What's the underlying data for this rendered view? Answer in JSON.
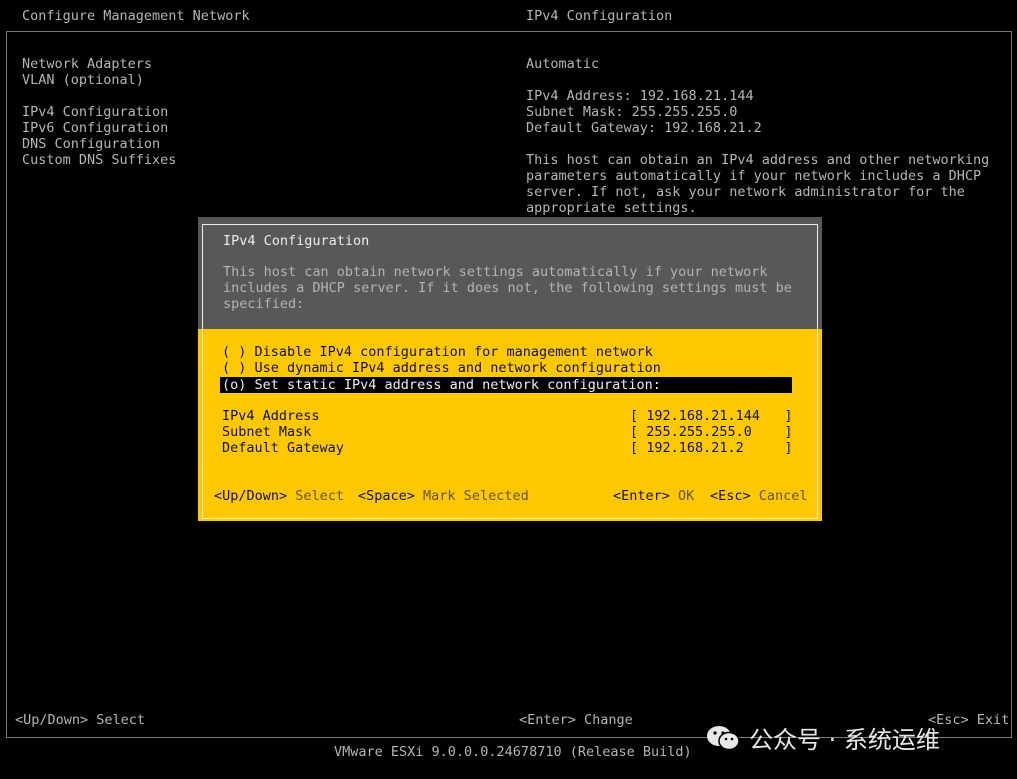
{
  "left_pane": {
    "title": "Configure Management Network",
    "items": [
      "Network Adapters",
      "VLAN (optional)",
      "IPv4 Configuration",
      "IPv6 Configuration",
      "DNS Configuration",
      "Custom DNS Suffixes"
    ]
  },
  "right_pane": {
    "title": "IPv4 Configuration",
    "mode": "Automatic",
    "ip_line": "IPv4 Address: 192.168.21.144",
    "mask_line": "Subnet Mask: 255.255.255.0",
    "gateway_line": "Default Gateway: 192.168.21.2",
    "description": [
      "This host can obtain an IPv4 address and other networking",
      "parameters automatically if your network includes a DHCP",
      "server. If not, ask your network administrator for the",
      "appropriate settings."
    ]
  },
  "dialog": {
    "title": "IPv4 Configuration",
    "description": [
      "This host can obtain network settings automatically if your network",
      "includes a DHCP server. If it does not, the following settings must be",
      "specified:"
    ],
    "options": [
      "( ) Disable IPv4 configuration for management network",
      "( ) Use dynamic IPv4 address and network configuration",
      "(o) Set static IPv4 address and network configuration:"
    ],
    "fields": {
      "ip_label": "IPv4 Address",
      "ip_value": "[ 192.168.21.144   ]",
      "mask_label": "Subnet Mask",
      "mask_value": "[ 255.255.255.0    ]",
      "gateway_label": "Default Gateway",
      "gateway_value": "[ 192.168.21.2     ]"
    },
    "footer": {
      "updown_key": "<Up/Down>",
      "updown_action": "Select",
      "space_key": "<Space>",
      "space_action": "Mark Selected",
      "enter_key": "<Enter>",
      "enter_action": "OK",
      "esc_key": "<Esc>",
      "esc_action": "Cancel"
    }
  },
  "bottom_bar": {
    "left": "<Up/Down> Select",
    "center": "<Enter> Change",
    "right": "<Esc> Exit"
  },
  "version": "VMware ESXi 9.0.0.0.24678710 (Release Build)",
  "watermark": "公众号 · 系统运维"
}
